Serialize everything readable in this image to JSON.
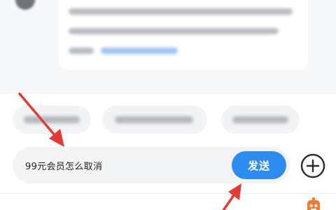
{
  "chat": {
    "avatar_icon": "user-avatar-icon"
  },
  "input": {
    "value": "99元会员怎么取消",
    "send_label": "发送",
    "add_icon": "plus-circle-icon"
  },
  "footer": {
    "robot_icon": "robot-icon"
  },
  "colors": {
    "accent": "#2d8cf0",
    "annotation_arrow": "#e53935"
  }
}
